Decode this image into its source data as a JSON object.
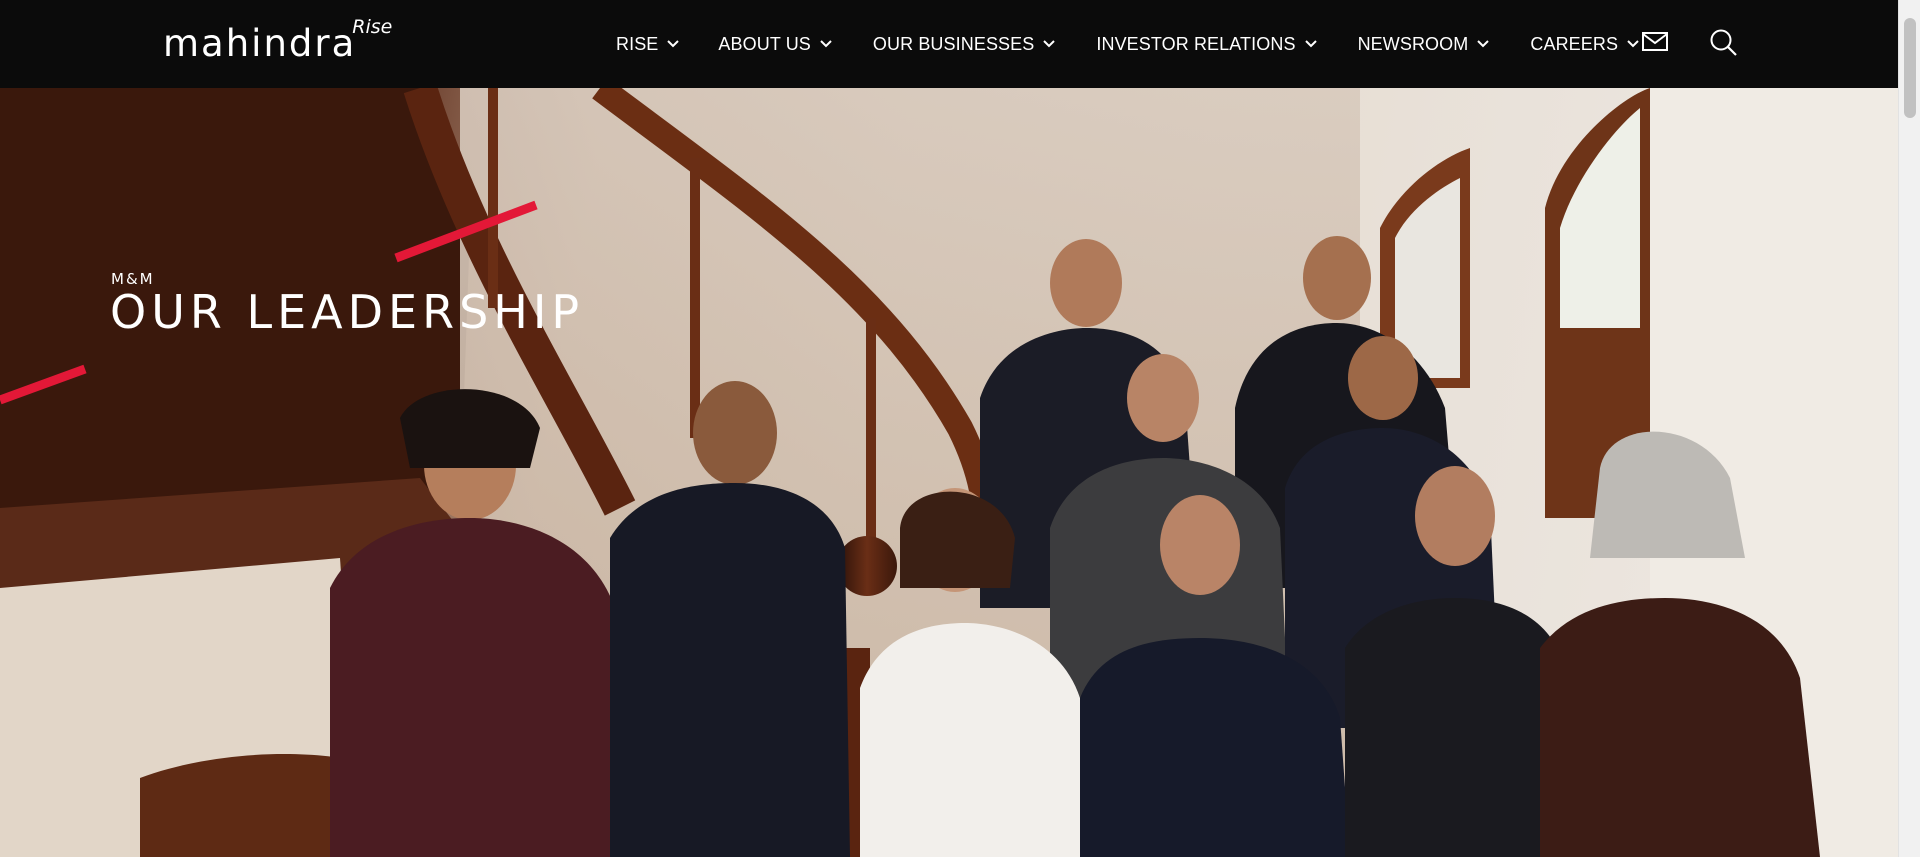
{
  "header": {
    "logo": {
      "word": "mahindra",
      "superscript": "Rise"
    },
    "nav": [
      {
        "label": "RISE"
      },
      {
        "label": "ABOUT US"
      },
      {
        "label": "OUR BUSINESSES"
      },
      {
        "label": "INVESTOR RELATIONS"
      },
      {
        "label": "NEWSROOM"
      },
      {
        "label": "CAREERS"
      }
    ],
    "icons": {
      "mail": "mail-icon",
      "search": "search-icon",
      "chevron": "chevron-down-icon"
    }
  },
  "hero": {
    "eyebrow": "M&M",
    "title": "OUR LEADERSHIP",
    "accent_color": "#e31837",
    "image": "leadership-group-photo"
  },
  "colors": {
    "header_bg": "#0b0b0b",
    "text": "#ffffff",
    "accent": "#e31837"
  }
}
